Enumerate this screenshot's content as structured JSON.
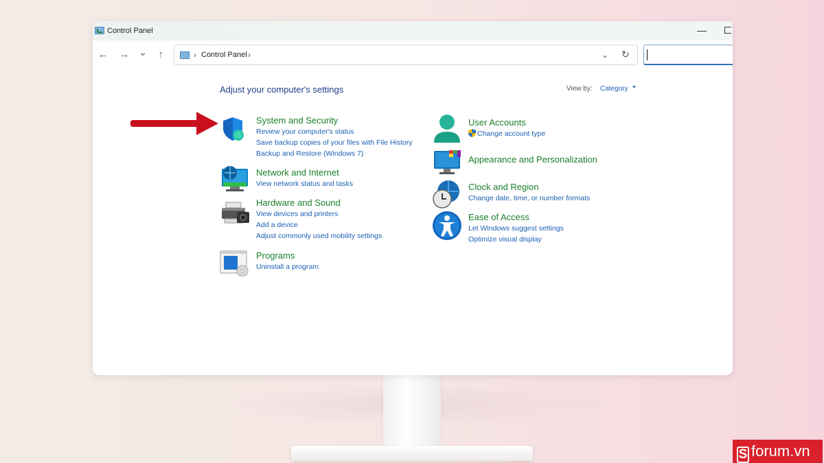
{
  "window": {
    "title": "Control Panel",
    "minimize_glyph": "—"
  },
  "address": {
    "path_label": "Control Panel",
    "separator": "›",
    "search_placeholder": ""
  },
  "nav": {
    "back": "←",
    "forward": "→",
    "recent": "⌄",
    "up": "↑",
    "dropdown": "⌄",
    "refresh": "↻"
  },
  "header": {
    "title": "Adjust your computer's settings",
    "view_by_label": "View by:",
    "view_by_value": "Category"
  },
  "categories": [
    {
      "id": "system-security",
      "title": "System and Security",
      "icon": "shield-icon",
      "links": [
        "Review your computer's status",
        "Save backup copies of your files with File History",
        "Backup and Restore (Windows 7)"
      ]
    },
    {
      "id": "network-internet",
      "title": "Network and Internet",
      "icon": "network-globe-icon",
      "links": [
        "View network status and tasks"
      ]
    },
    {
      "id": "hardware-sound",
      "title": "Hardware and Sound",
      "icon": "printer-icon",
      "links": [
        "View devices and printers",
        "Add a device",
        "Adjust commonly used mobility settings"
      ]
    },
    {
      "id": "programs",
      "title": "Programs",
      "icon": "programs-disc-icon",
      "links": [
        "Uninstall a program"
      ]
    },
    {
      "id": "user-accounts",
      "title": "User Accounts",
      "icon": "user-icon",
      "links": [
        "Change account type"
      ]
    },
    {
      "id": "appearance",
      "title": "Appearance and Personalization",
      "icon": "monitor-palette-icon",
      "links": []
    },
    {
      "id": "clock-region",
      "title": "Clock and Region",
      "icon": "clock-globe-icon",
      "links": [
        "Change date, time, or number formats"
      ]
    },
    {
      "id": "ease-access",
      "title": "Ease of Access",
      "icon": "accessibility-icon",
      "links": [
        "Let Windows suggest settings",
        "Optimize visual display"
      ]
    }
  ],
  "branding": {
    "logo_letter": "S",
    "logo_text": "forum.vn"
  },
  "colors": {
    "category_title": "#1b7f2a",
    "link": "#1a5fb4",
    "heading": "#1e3f8a",
    "arrow": "#c8101e",
    "logo_bg": "#d9212c"
  }
}
